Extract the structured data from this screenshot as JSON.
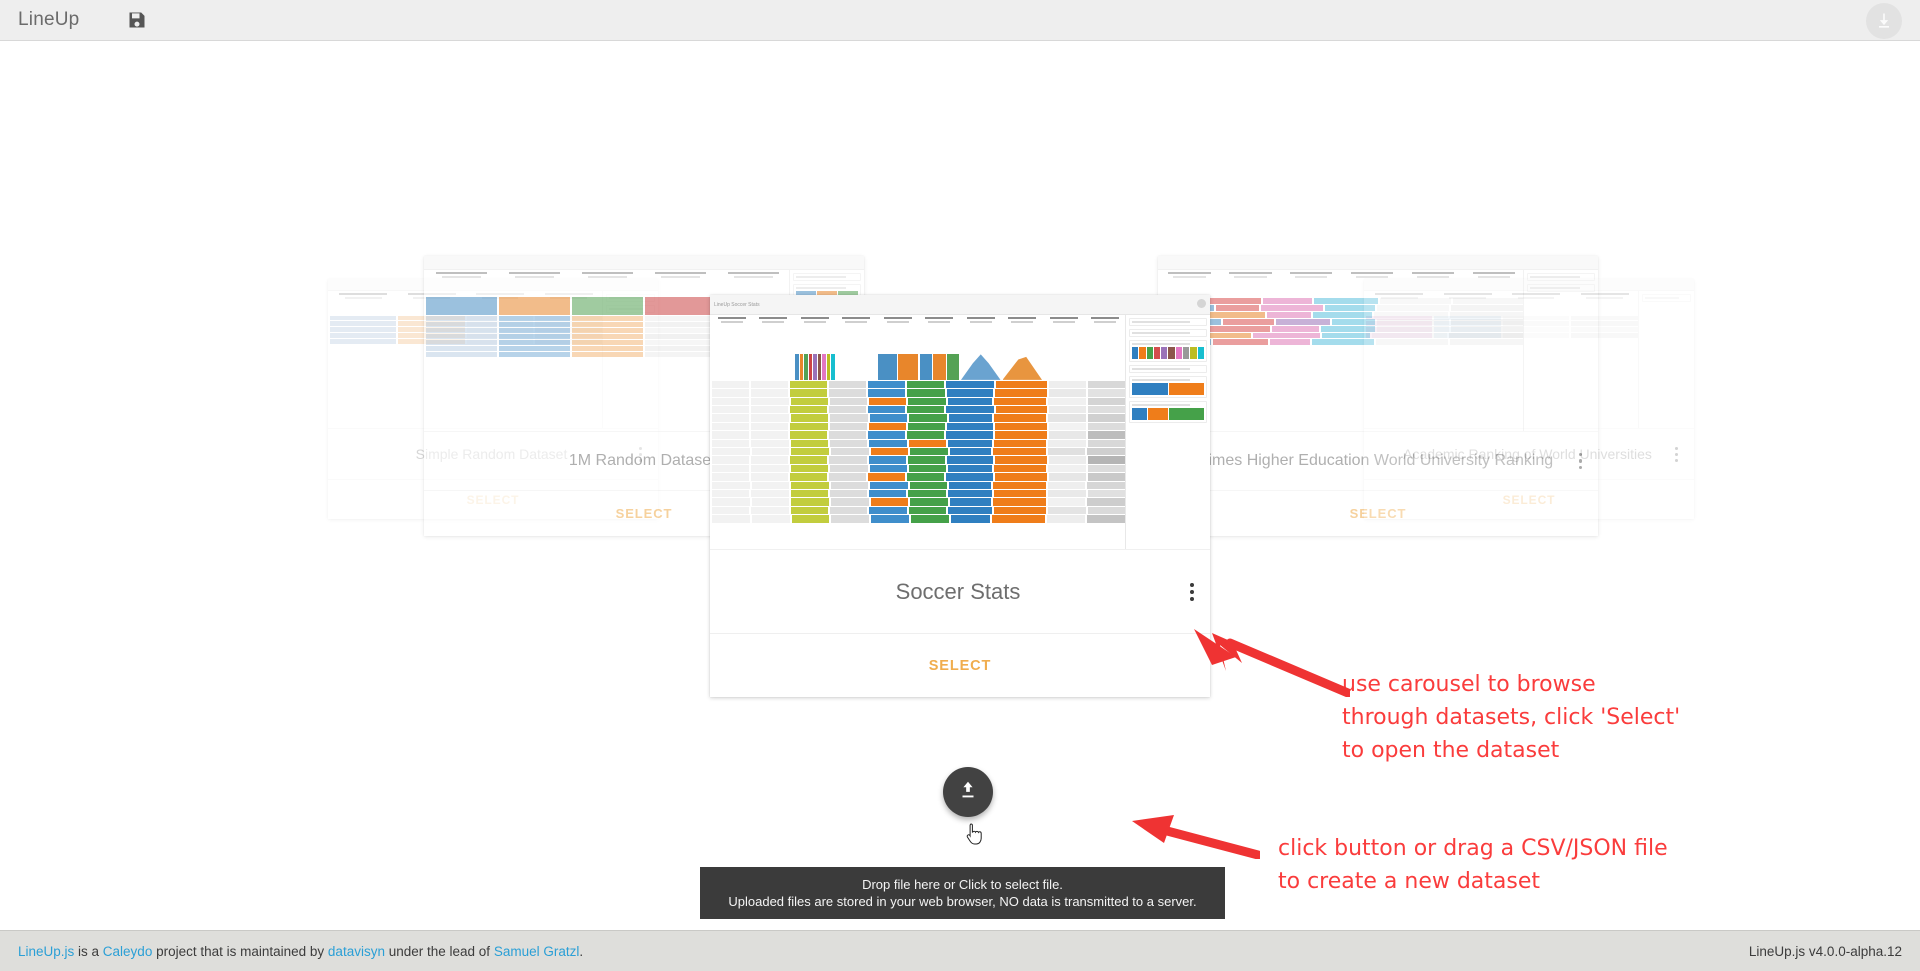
{
  "header": {
    "brand": "LineUp",
    "save_icon": "floppy-disk-save-icon",
    "download_icon": "download-circle-icon"
  },
  "carousel": {
    "cards": [
      {
        "title": "Simple Random Dataset",
        "select_label": "SELECT",
        "menu_icon": "kebab-menu-icon"
      },
      {
        "title": "1M Random Dataset",
        "select_label": "SELECT",
        "menu_icon": "kebab-menu-icon"
      },
      {
        "title": "Soccer Stats",
        "select_label": "SELECT",
        "menu_icon": "kebab-menu-icon"
      },
      {
        "title": "Times Higher Education World University Ranking",
        "select_label": "SELECT",
        "menu_icon": "kebab-menu-icon"
      },
      {
        "title": "Academic Ranking of World Universities",
        "select_label": "SELECT",
        "menu_icon": "kebab-menu-icon"
      }
    ],
    "thumbnail_caption": "LineUp Soccer Stats"
  },
  "upload": {
    "fab_icon": "upload-icon",
    "tooltip_line1": "Drop file here or Click to select file.",
    "tooltip_line2": "Uploaded files are stored in your web browser, NO data is transmitted to a server.",
    "cursor_icon": "pointer-hand-cursor"
  },
  "annotations": {
    "carousel_note": "use carousel to browse\nthrough datasets, click 'Select'\nto open the dataset",
    "upload_note": "click button or drag a CSV/JSON file\nto create a new dataset",
    "color": "#fa3c3c",
    "arrow_icon": "red-arrow-icon"
  },
  "footer": {
    "text_1": "LineUp.js",
    "text_2": " is a ",
    "text_3": "Caleydo",
    "text_4": " project that is maintained by ",
    "text_5": "datavisyn",
    "text_6": " under the lead of ",
    "text_7": "Samuel Gratzl",
    "text_8": ".",
    "version": "LineUp.js v4.0.0-alpha.12",
    "link_color": "#2a9fd6"
  },
  "theme": {
    "accent": "#f0ad4e",
    "header_bg": "#eeeeee",
    "footer_bg": "#dededb",
    "fab_bg": "#424242"
  }
}
